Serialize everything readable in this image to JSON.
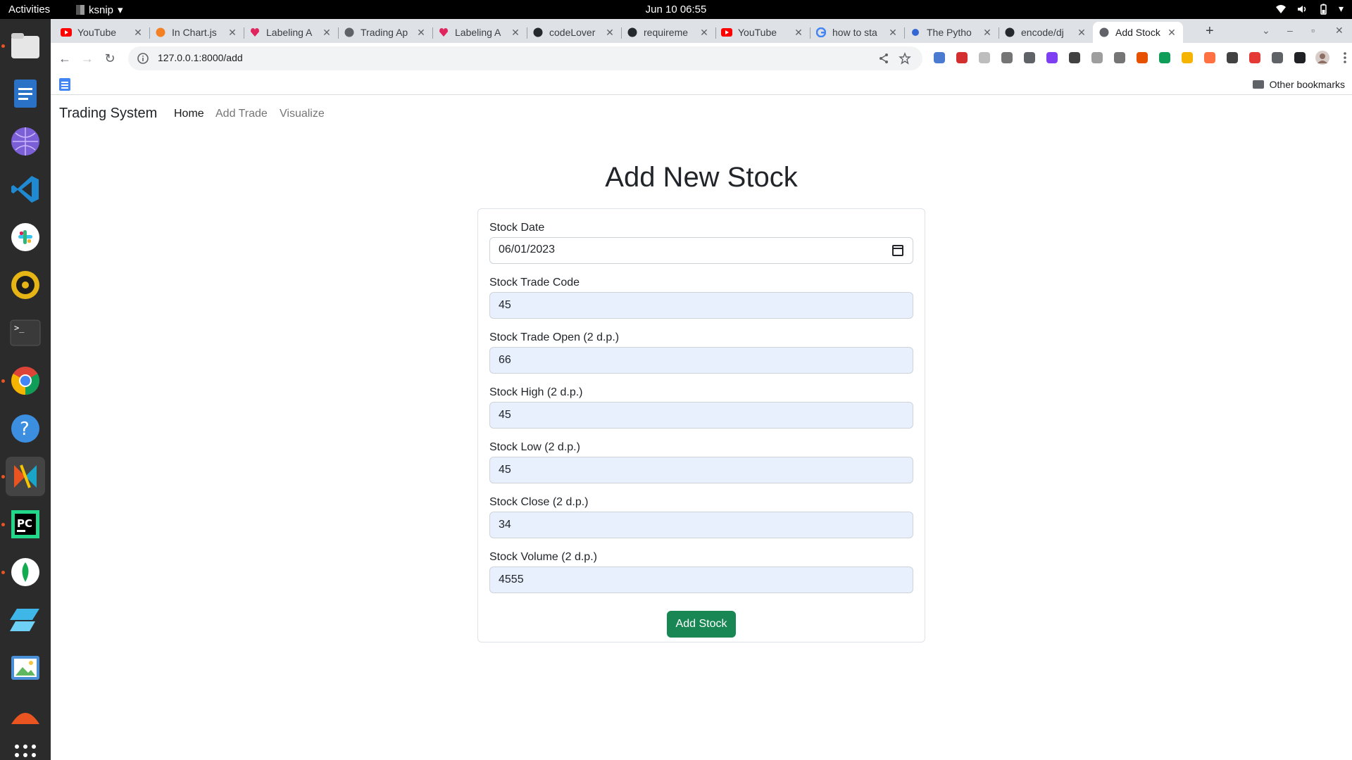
{
  "system_bar": {
    "activities": "Activities",
    "app_name": "ksnip",
    "clock": "Jun 10  06:55"
  },
  "browser": {
    "tabs": [
      {
        "title": "YouTube",
        "icon": "youtube-icon"
      },
      {
        "title": "In Chart.js",
        "icon": "stackoverflow-icon"
      },
      {
        "title": "Labeling A",
        "icon": "labeling-icon"
      },
      {
        "title": "Trading Ap",
        "icon": "globe-icon"
      },
      {
        "title": "Labeling A",
        "icon": "labeling-icon"
      },
      {
        "title": "codeLover",
        "icon": "github-icon"
      },
      {
        "title": "requireme",
        "icon": "github-icon"
      },
      {
        "title": "YouTube",
        "icon": "youtube-icon"
      },
      {
        "title": "how to sta",
        "icon": "google-icon"
      },
      {
        "title": "The Pytho",
        "icon": "dot-icon"
      },
      {
        "title": "encode/dj",
        "icon": "github-icon"
      },
      {
        "title": "Add Stock",
        "icon": "globe-icon",
        "active": true
      }
    ],
    "url": "127.0.0.1:8000/add",
    "other_bookmarks": "Other bookmarks"
  },
  "app": {
    "brand": "Trading System",
    "nav": [
      {
        "label": "Home",
        "current": true
      },
      {
        "label": "Add Trade",
        "current": false
      },
      {
        "label": "Visualize",
        "current": false
      }
    ],
    "title": "Add New Stock",
    "form": {
      "date_label": "Stock Date",
      "date_value": "06/01/2023",
      "trade_code_label": "Stock Trade Code",
      "trade_code_value": "45",
      "open_label": "Stock Trade Open (2 d.p.)",
      "open_value": "66",
      "high_label": "Stock High (2 d.p.)",
      "high_value": "45",
      "low_label": "Stock Low (2 d.p.)",
      "low_value": "45",
      "close_label": "Stock Close (2 d.p.)",
      "close_value": "34",
      "volume_label": "Stock Volume (2 d.p.)",
      "volume_value": "4555",
      "submit_label": "Add Stock"
    }
  },
  "colors": {
    "submit": "#198754",
    "autofill": "#e8f0fe"
  }
}
